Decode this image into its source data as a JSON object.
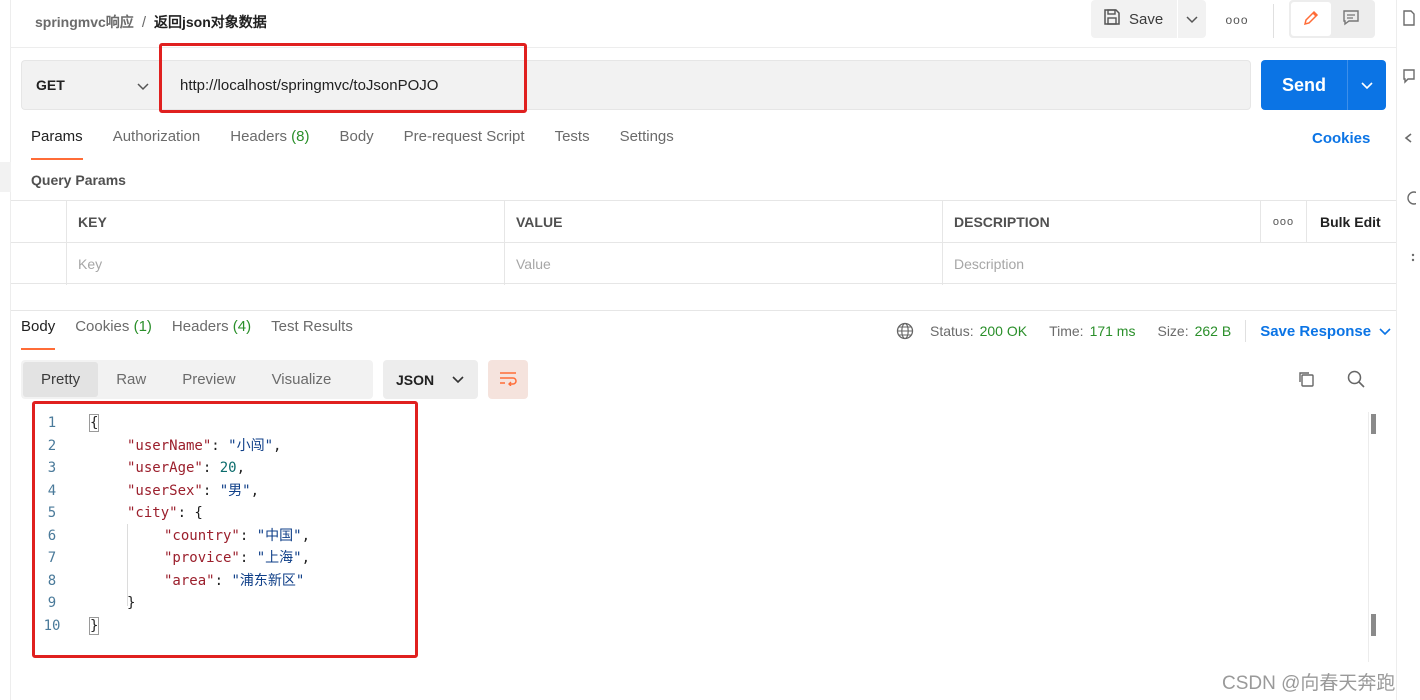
{
  "breadcrumb": {
    "parent": "springmvc响应",
    "separator": "/",
    "current": "返回json对象数据"
  },
  "toolbar": {
    "save_label": "Save",
    "more_label": "ooo"
  },
  "request": {
    "method": "GET",
    "url": "http://localhost/springmvc/toJsonPOJO",
    "send_label": "Send"
  },
  "request_tabs": [
    {
      "label": "Params",
      "active": true
    },
    {
      "label": "Authorization"
    },
    {
      "label": "Headers",
      "count": "(8)"
    },
    {
      "label": "Body"
    },
    {
      "label": "Pre-request Script"
    },
    {
      "label": "Tests"
    },
    {
      "label": "Settings"
    }
  ],
  "cookies_label": "Cookies",
  "query_params": {
    "title": "Query Params",
    "columns": [
      "KEY",
      "VALUE",
      "DESCRIPTION"
    ],
    "more_label": "ooo",
    "bulk_edit_label": "Bulk Edit",
    "placeholders": [
      "Key",
      "Value",
      "Description"
    ]
  },
  "response_tabs": [
    {
      "label": "Body",
      "active": true
    },
    {
      "label": "Cookies",
      "count": "(1)"
    },
    {
      "label": "Headers",
      "count": "(4)"
    },
    {
      "label": "Test Results"
    }
  ],
  "status": {
    "status_label": "Status:",
    "status_value": "200 OK",
    "time_label": "Time:",
    "time_value": "171 ms",
    "size_label": "Size:",
    "size_value": "262 B",
    "save_response_label": "Save Response"
  },
  "view_modes": [
    "Pretty",
    "Raw",
    "Preview",
    "Visualize"
  ],
  "format": "JSON",
  "code_lines": [
    {
      "n": "1",
      "indent": 0,
      "tokens": [
        [
          "p",
          "{"
        ]
      ]
    },
    {
      "n": "2",
      "indent": 1,
      "tokens": [
        [
          "k",
          "\"userName\""
        ],
        [
          "p",
          ": "
        ],
        [
          "s",
          "\"小闯\""
        ],
        [
          "p",
          ","
        ]
      ]
    },
    {
      "n": "3",
      "indent": 1,
      "tokens": [
        [
          "k",
          "\"userAge\""
        ],
        [
          "p",
          ": "
        ],
        [
          "n",
          "20"
        ],
        [
          "p",
          ","
        ]
      ]
    },
    {
      "n": "4",
      "indent": 1,
      "tokens": [
        [
          "k",
          "\"userSex\""
        ],
        [
          "p",
          ": "
        ],
        [
          "s",
          "\"男\""
        ],
        [
          "p",
          ","
        ]
      ]
    },
    {
      "n": "5",
      "indent": 1,
      "tokens": [
        [
          "k",
          "\"city\""
        ],
        [
          "p",
          ": {"
        ]
      ]
    },
    {
      "n": "6",
      "indent": 2,
      "tokens": [
        [
          "k",
          "\"country\""
        ],
        [
          "p",
          ": "
        ],
        [
          "s",
          "\"中国\""
        ],
        [
          "p",
          ","
        ]
      ]
    },
    {
      "n": "7",
      "indent": 2,
      "tokens": [
        [
          "k",
          "\"provice\""
        ],
        [
          "p",
          ": "
        ],
        [
          "s",
          "\"上海\""
        ],
        [
          "p",
          ","
        ]
      ]
    },
    {
      "n": "8",
      "indent": 2,
      "tokens": [
        [
          "k",
          "\"area\""
        ],
        [
          "p",
          ": "
        ],
        [
          "s",
          "\"浦东新区\""
        ]
      ]
    },
    {
      "n": "9",
      "indent": 1,
      "tokens": [
        [
          "p",
          "}"
        ]
      ]
    },
    {
      "n": "10",
      "indent": 0,
      "tokens": [
        [
          "p",
          "}"
        ]
      ]
    }
  ],
  "watermark": "CSDN @向春天奔跑",
  "colors": {
    "accent": "#0b74e5",
    "tab_underline": "#ff6c37",
    "success": "#2a8f2a",
    "annotation": "#e0201f"
  }
}
